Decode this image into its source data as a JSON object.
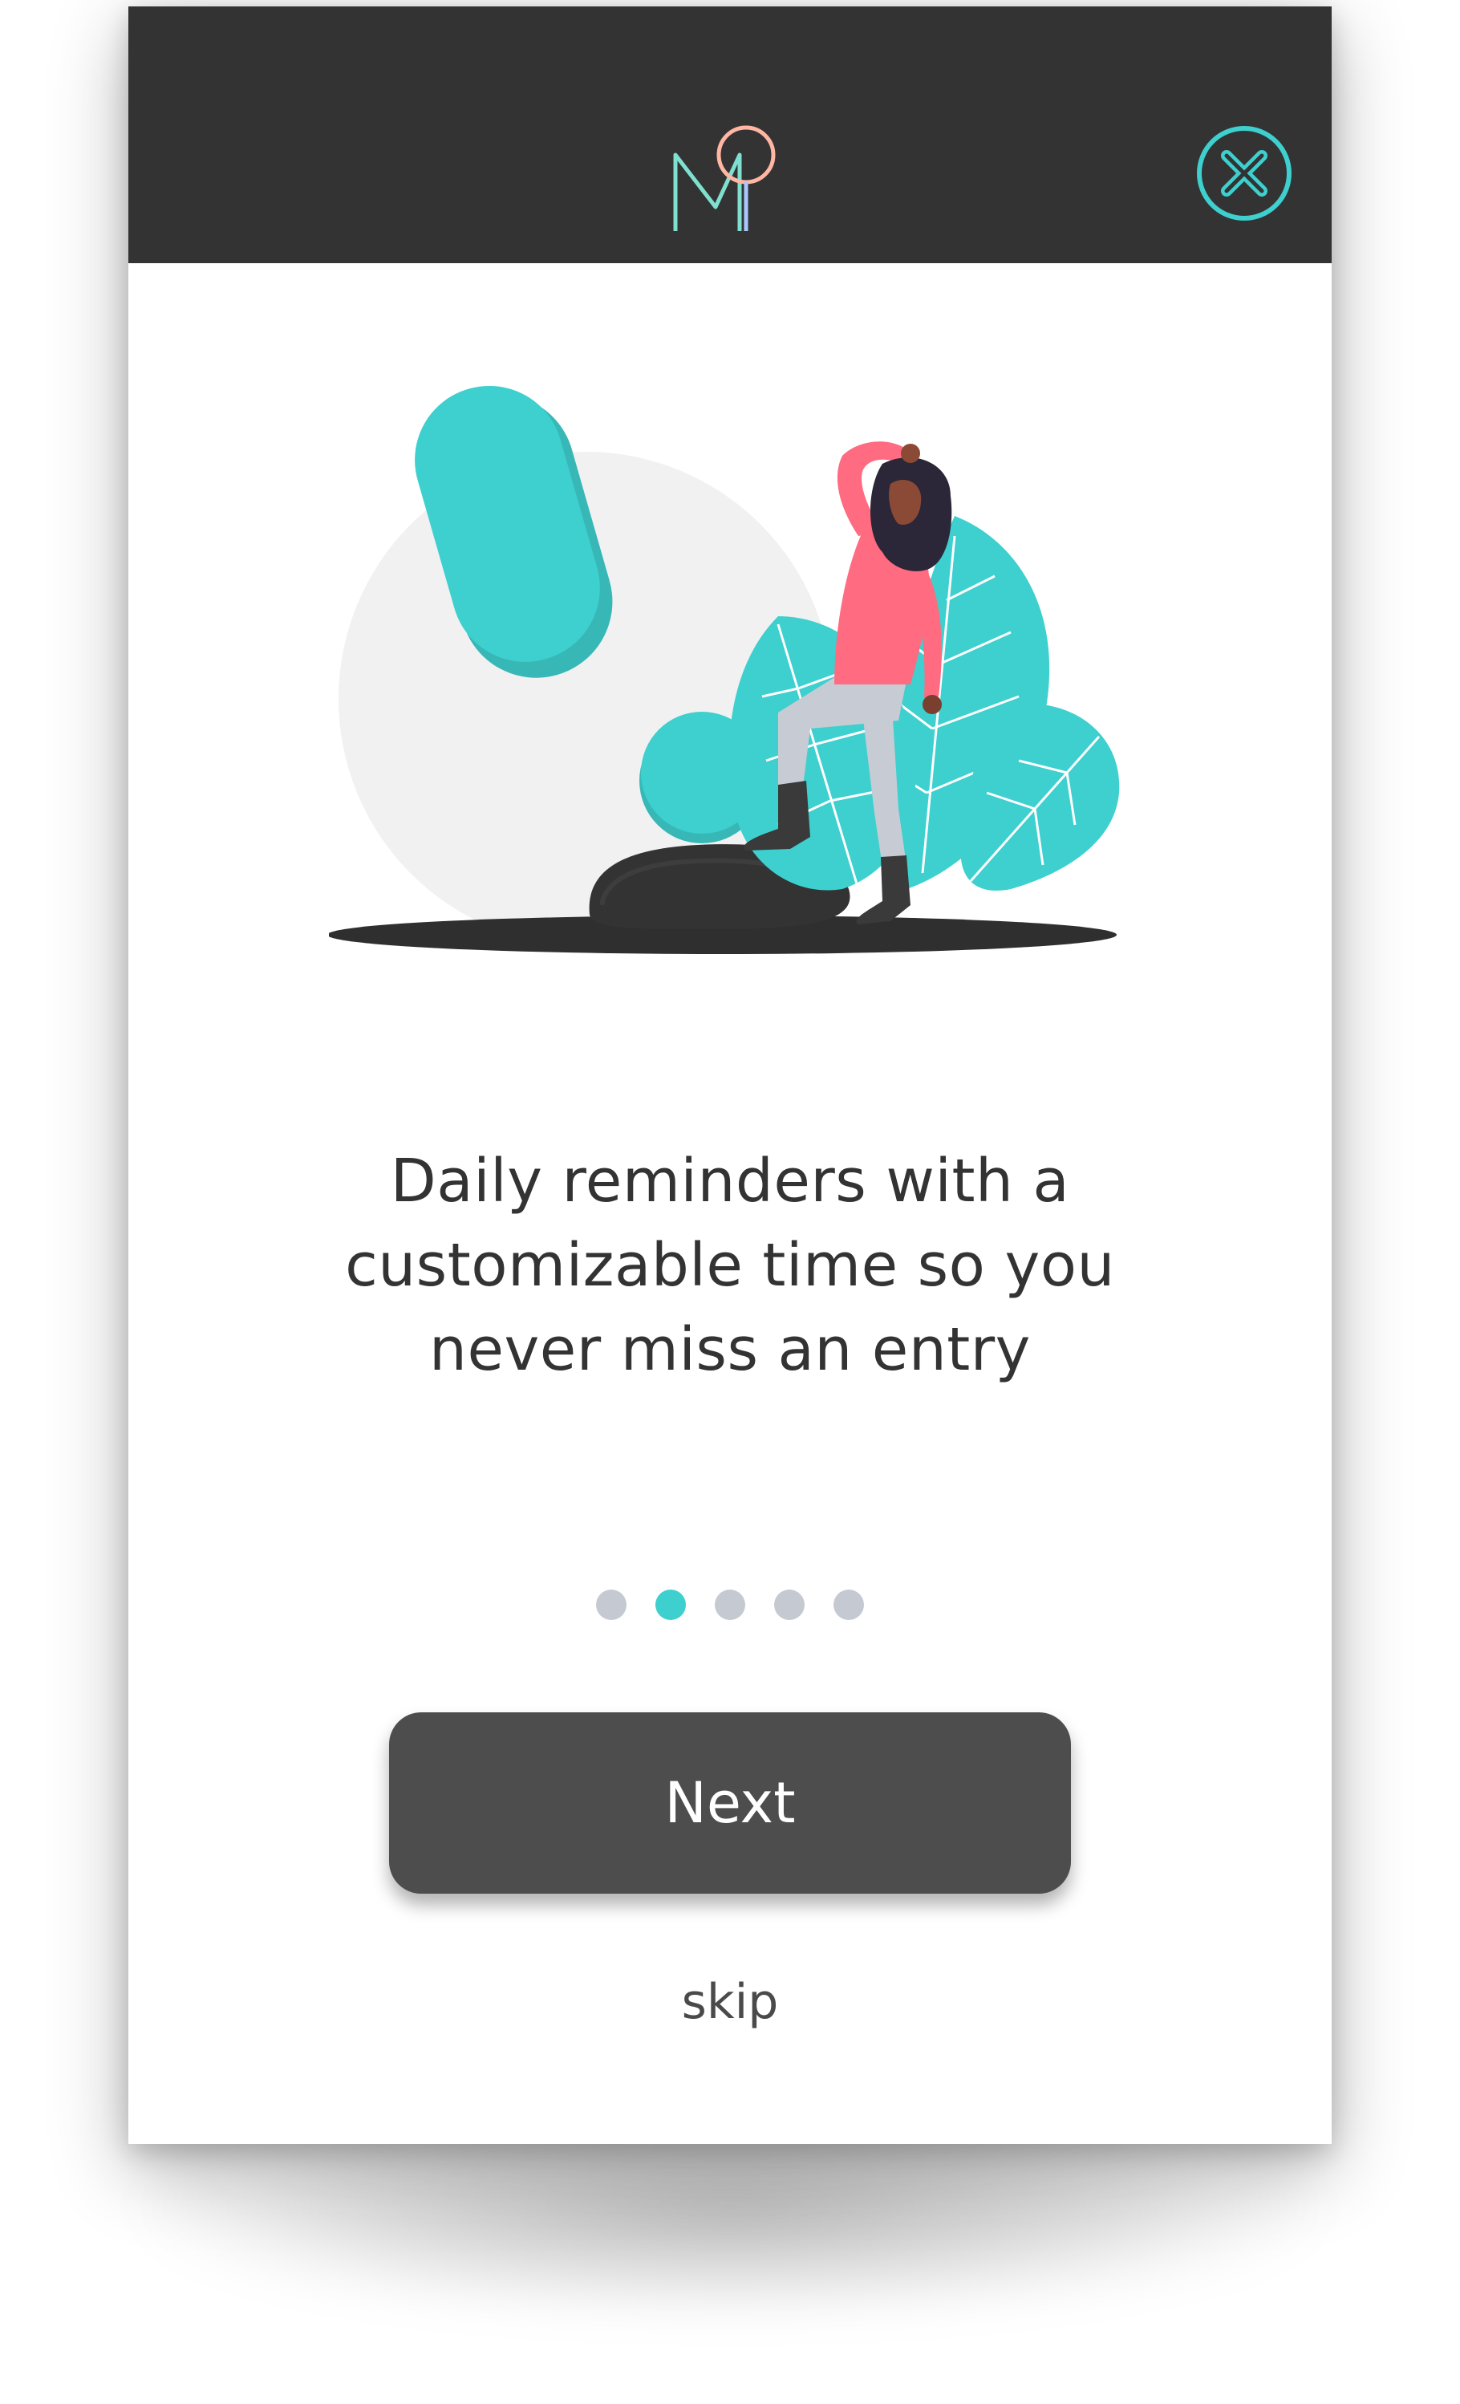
{
  "app": {
    "logo_icon": "mq-logo-icon",
    "close_icon": "close-circle-icon"
  },
  "illustration": {
    "name": "reminder-woman-exclamation-illustration"
  },
  "onboarding": {
    "headline": "Daily reminders with a\ncustomizable time so you\nnever miss an entry",
    "page_count": 5,
    "active_page": 2
  },
  "actions": {
    "next_label": "Next",
    "skip_label": "skip"
  },
  "colors": {
    "accent": "#3ecfcf",
    "header": "#333333",
    "button": "#4d4d4d",
    "dot_inactive": "#c5c9d2",
    "pink": "#ff6b81"
  }
}
